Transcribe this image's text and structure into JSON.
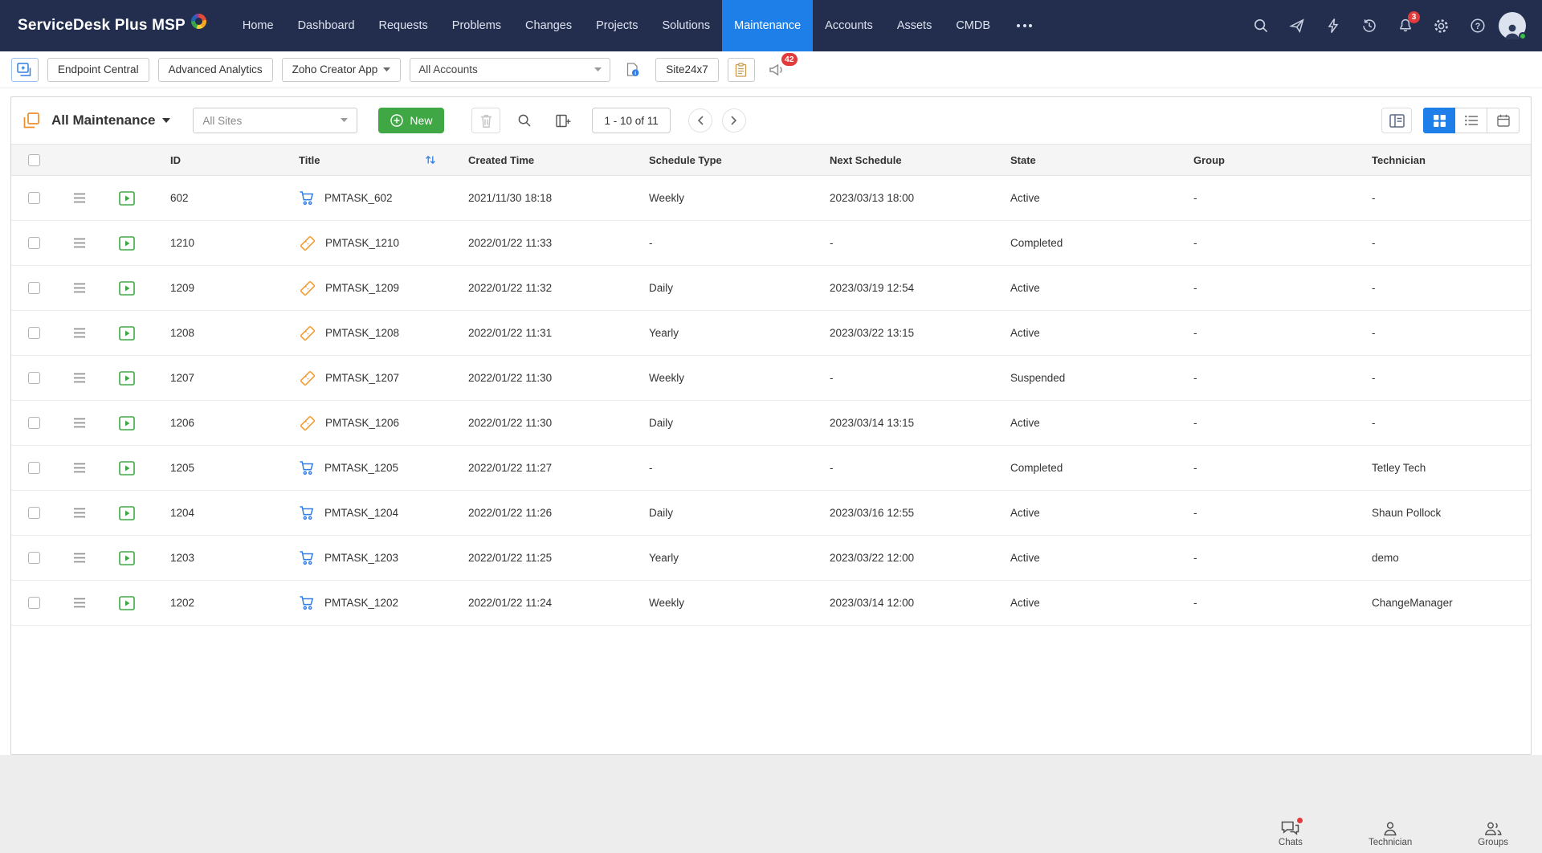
{
  "brand": {
    "name": "ServiceDesk Plus MSP"
  },
  "nav": {
    "items": [
      {
        "label": "Home",
        "active": false
      },
      {
        "label": "Dashboard",
        "active": false
      },
      {
        "label": "Requests",
        "active": false
      },
      {
        "label": "Problems",
        "active": false
      },
      {
        "label": "Changes",
        "active": false
      },
      {
        "label": "Projects",
        "active": false
      },
      {
        "label": "Solutions",
        "active": false
      },
      {
        "label": "Maintenance",
        "active": true
      },
      {
        "label": "Accounts",
        "active": false
      },
      {
        "label": "Assets",
        "active": false
      },
      {
        "label": "CMDB",
        "active": false
      }
    ],
    "notification_count": "3"
  },
  "toolbar": {
    "endpoint_central": "Endpoint Central",
    "advanced_analytics": "Advanced Analytics",
    "zoho_creator": "Zoho Creator App",
    "all_accounts": "All Accounts",
    "site24x7": "Site24x7",
    "announcement_count": "42"
  },
  "panel": {
    "title": "All Maintenance",
    "sites_filter": "All Sites",
    "new_button": "New",
    "pagination": "1 - 10 of 11"
  },
  "table": {
    "columns": [
      "ID",
      "Title",
      "Created Time",
      "Schedule Type",
      "Next Schedule",
      "State",
      "Group",
      "Technician"
    ],
    "rows": [
      {
        "id": "602",
        "icon": "cart",
        "title": "PMTASK_602",
        "created": "2021/11/30 18:18",
        "schedule": "Weekly",
        "next": "2023/03/13 18:00",
        "state": "Active",
        "group": "-",
        "technician": "-"
      },
      {
        "id": "1210",
        "icon": "ticket",
        "title": "PMTASK_1210",
        "created": "2022/01/22 11:33",
        "schedule": "-",
        "next": "-",
        "state": "Completed",
        "group": "-",
        "technician": "-"
      },
      {
        "id": "1209",
        "icon": "ticket",
        "title": "PMTASK_1209",
        "created": "2022/01/22 11:32",
        "schedule": "Daily",
        "next": "2023/03/19 12:54",
        "state": "Active",
        "group": "-",
        "technician": "-"
      },
      {
        "id": "1208",
        "icon": "ticket",
        "title": "PMTASK_1208",
        "created": "2022/01/22 11:31",
        "schedule": "Yearly",
        "next": "2023/03/22 13:15",
        "state": "Active",
        "group": "-",
        "technician": "-"
      },
      {
        "id": "1207",
        "icon": "ticket",
        "title": "PMTASK_1207",
        "created": "2022/01/22 11:30",
        "schedule": "Weekly",
        "next": "-",
        "state": "Suspended",
        "group": "-",
        "technician": "-"
      },
      {
        "id": "1206",
        "icon": "ticket",
        "title": "PMTASK_1206",
        "created": "2022/01/22 11:30",
        "schedule": "Daily",
        "next": "2023/03/14 13:15",
        "state": "Active",
        "group": "-",
        "technician": "-"
      },
      {
        "id": "1205",
        "icon": "cart",
        "title": "PMTASK_1205",
        "created": "2022/01/22 11:27",
        "schedule": "-",
        "next": "-",
        "state": "Completed",
        "group": "-",
        "technician": "Tetley Tech"
      },
      {
        "id": "1204",
        "icon": "cart",
        "title": "PMTASK_1204",
        "created": "2022/01/22 11:26",
        "schedule": "Daily",
        "next": "2023/03/16 12:55",
        "state": "Active",
        "group": "-",
        "technician": "Shaun Pollock"
      },
      {
        "id": "1203",
        "icon": "cart",
        "title": "PMTASK_1203",
        "created": "2022/01/22 11:25",
        "schedule": "Yearly",
        "next": "2023/03/22 12:00",
        "state": "Active",
        "group": "-",
        "technician": "demo"
      },
      {
        "id": "1202",
        "icon": "cart",
        "title": "PMTASK_1202",
        "created": "2022/01/22 11:24",
        "schedule": "Weekly",
        "next": "2023/03/14 12:00",
        "state": "Active",
        "group": "-",
        "technician": "ChangeManager"
      }
    ]
  },
  "footer": {
    "items": [
      {
        "label": "Chats",
        "icon": "chat-icon",
        "badge_dot": true
      },
      {
        "label": "Technician",
        "icon": "technician-icon",
        "badge_dot": false
      },
      {
        "label": "Groups",
        "icon": "groups-icon",
        "badge_dot": false
      }
    ]
  },
  "colors": {
    "nav_bg": "#232e4f",
    "active_nav": "#1f7fe8",
    "green": "#3fa845",
    "badge_red": "#e23b3b",
    "icon_blue": "#2e7ee5",
    "icon_orange": "#f29c2f"
  }
}
